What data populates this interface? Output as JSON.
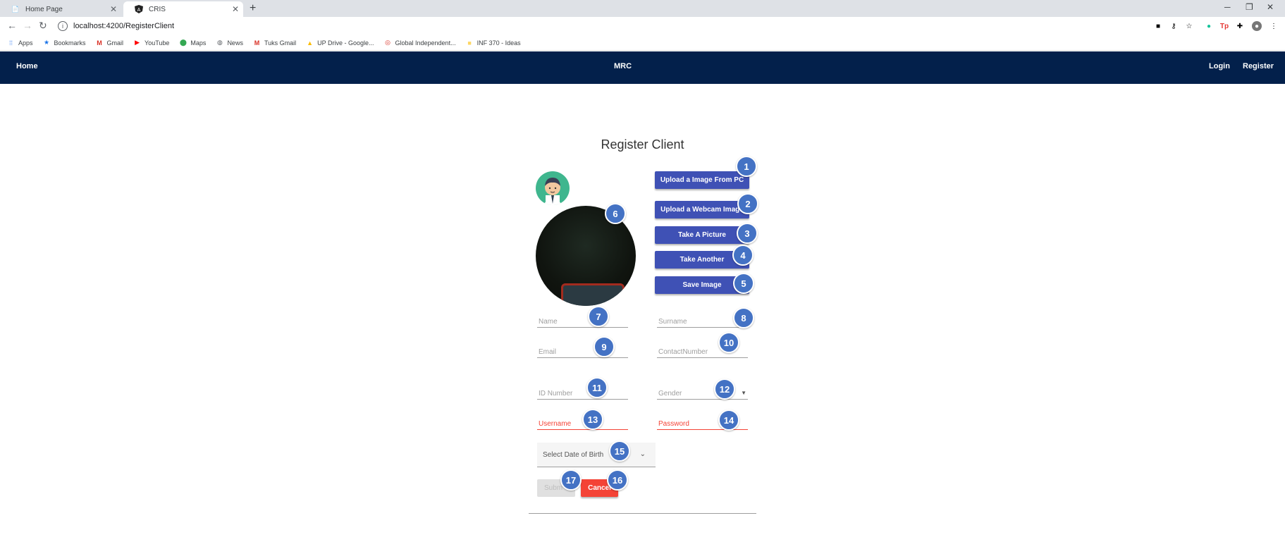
{
  "browser": {
    "tabs": [
      {
        "title": "Home Page",
        "active": false
      },
      {
        "title": "CRIS",
        "active": true
      }
    ],
    "url": "localhost:4200/RegisterClient",
    "bookmarks": [
      "Apps",
      "Bookmarks",
      "Gmail",
      "YouTube",
      "Maps",
      "News",
      "Tuks Gmail",
      "UP Drive - Google...",
      "Global Independent...",
      "INF 370 - Ideas"
    ]
  },
  "navbar": {
    "home": "Home",
    "brand": "MRC",
    "login": "Login",
    "register": "Register"
  },
  "form": {
    "title": "Register Client",
    "buttons": {
      "upload_pc": "Upload a Image From PC",
      "upload_webcam": "Upload a Webcam Image",
      "take_picture": "Take A Picture",
      "take_another": "Take Another",
      "save_image": "Save Image",
      "submit": "Subm",
      "cancel": "Cancel"
    },
    "fields": {
      "name": "Name",
      "surname": "Surname",
      "email": "Email",
      "contact": "ContactNumber",
      "id_number": "ID Number",
      "gender": "Gender",
      "username": "Username",
      "password": "Password",
      "dob": "Select Date of Birth"
    }
  },
  "annotations": [
    "1",
    "2",
    "3",
    "4",
    "5",
    "6",
    "7",
    "8",
    "9",
    "10",
    "11",
    "12",
    "13",
    "14",
    "15",
    "16",
    "17"
  ],
  "colors": {
    "navbar": "#03204b",
    "primary_button": "#3f51b5",
    "cancel_button": "#f44336",
    "badge": "#4472c4",
    "error": "#f44336"
  }
}
